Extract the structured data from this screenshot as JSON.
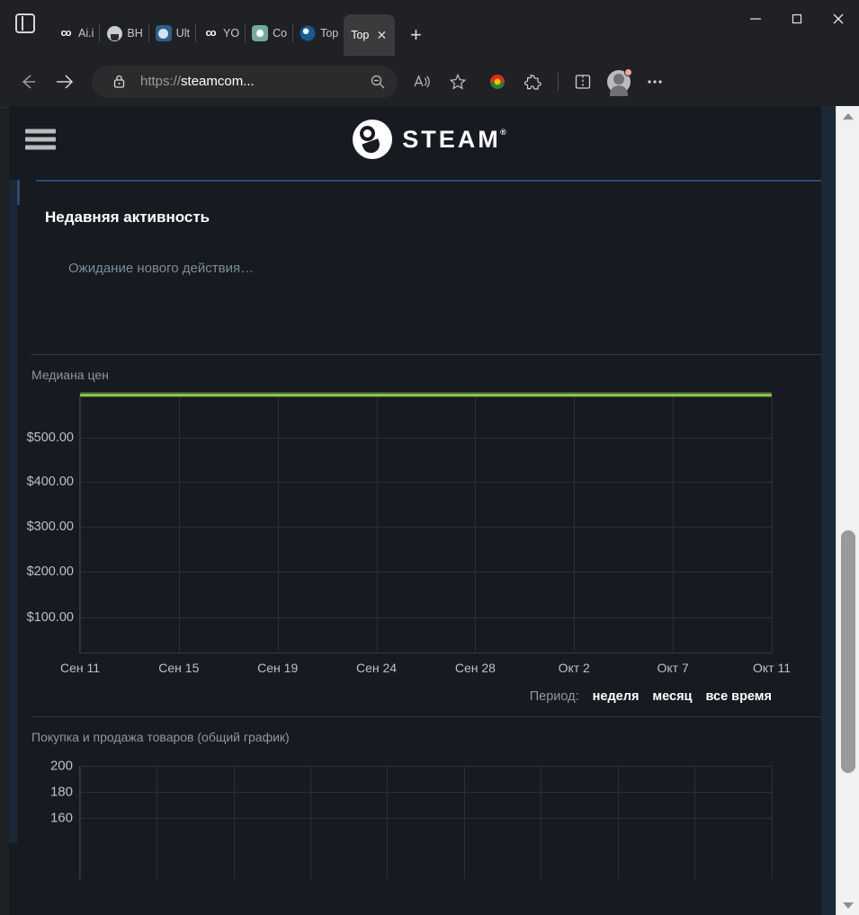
{
  "browser": {
    "sidebar_toggle": "sidebar-toggle",
    "tabs": [
      {
        "title": "Ai.i",
        "favicon": "co-icon",
        "active": false
      },
      {
        "title": "BH",
        "favicon": "github-icon",
        "active": false
      },
      {
        "title": "Ult",
        "favicon": "ultra-icon",
        "active": false
      },
      {
        "title": "YO",
        "favicon": "co-gold-icon",
        "active": false
      },
      {
        "title": "Co",
        "favicon": "openai-icon",
        "active": false
      },
      {
        "title": "Top",
        "favicon": "steam-icon",
        "active": false
      },
      {
        "title": "Top",
        "favicon": "none",
        "active": true
      }
    ],
    "new_tab_label": "+",
    "window_controls": {
      "minimize": "—",
      "maximize": "□",
      "close": "✕"
    },
    "nav": {
      "back": "back-arrow",
      "forward": "forward-arrow",
      "url_scheme": "https://",
      "url_host": "steamcom...",
      "url_full": "https://steamcom...",
      "lock": "lock-icon",
      "zoom_out": "zoom-out-icon",
      "read_aloud": "read-aloud-icon",
      "favorite": "star-icon",
      "extension": "extension-colored-icon",
      "extensions": "puzzle-icon",
      "split_screen": "split-screen-icon",
      "profile": "avatar-icon",
      "settings": "ellipsis-icon"
    }
  },
  "site": {
    "header": {
      "menu": "hamburger-menu",
      "logo_text": "STEAM",
      "logo_trademark": "®"
    },
    "recent": {
      "heading": "Недавняя активность",
      "empty_text": "Ожидание нового действия…"
    },
    "period": {
      "label": "Период:",
      "options": [
        "неделя",
        "месяц",
        "все время"
      ]
    }
  },
  "chart_data": [
    {
      "type": "line",
      "title": "Медиана цен",
      "xlabel": "",
      "ylabel": "",
      "x": [
        "Сен 11",
        "Сен 15",
        "Сен 19",
        "Сен 24",
        "Сен 28",
        "Окт 2",
        "Окт 7",
        "Окт 11"
      ],
      "yticks": [
        "$500.00",
        "$400.00",
        "$300.00",
        "$200.00",
        "$100.00"
      ],
      "ytick_values": [
        500,
        400,
        300,
        200,
        100
      ],
      "ylim": [
        0,
        580
      ],
      "grid": true,
      "legend": "none",
      "line_color": "#8bc34a",
      "series": [
        {
          "name": "Медиана цен",
          "values": [
            572,
            572,
            572,
            572,
            572,
            572,
            572,
            572
          ]
        }
      ]
    },
    {
      "type": "line",
      "title": "Покупка и продажа товаров (общий график)",
      "xlabel": "",
      "ylabel": "",
      "x": [],
      "yticks": [
        "200",
        "180",
        "160"
      ],
      "ytick_values": [
        200,
        180,
        160
      ],
      "ylim": [
        0,
        200
      ],
      "grid": true,
      "legend": "none",
      "series": []
    }
  ]
}
